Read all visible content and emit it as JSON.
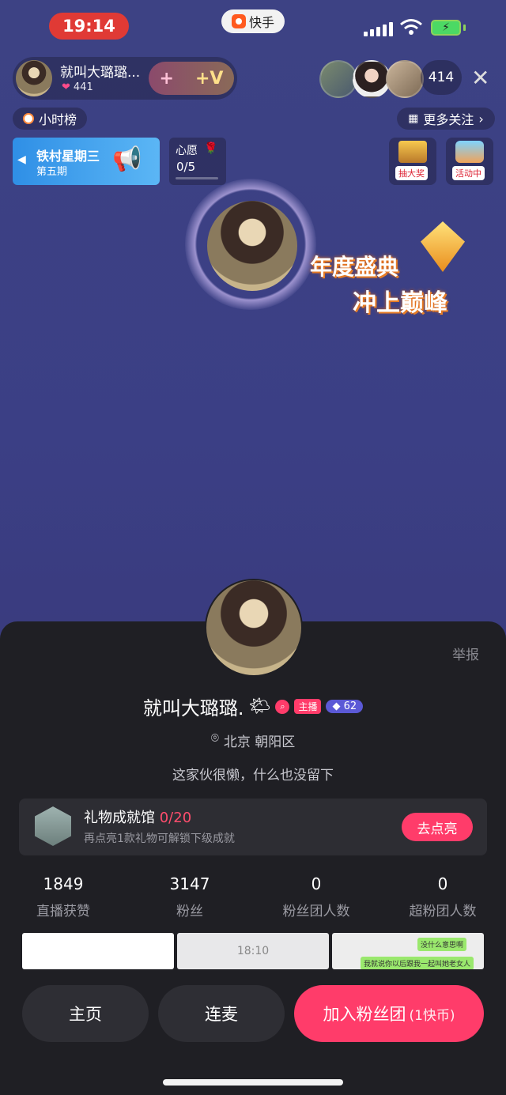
{
  "status_bar": {
    "time": "19:14",
    "app_name": "快手",
    "battery_icon": "charging-bolt"
  },
  "host": {
    "name": "就叫大璐璐...",
    "likes": "441",
    "plus_symbol": "+",
    "v_symbol": "+V"
  },
  "viewers": {
    "count": "414"
  },
  "close_symbol": "✕",
  "rank_label": "小时榜",
  "more_follow_label": "更多关注",
  "banner": {
    "title": "铁村星期三",
    "subtitle": "第五期"
  },
  "wish": {
    "label": "心愿",
    "count": "0/5"
  },
  "tiles": {
    "lottery": "抽大奖",
    "activity": "活动中"
  },
  "promo": {
    "line1": "年度盛典",
    "line2": "冲上巅峰"
  },
  "profile": {
    "report": "举报",
    "name": "就叫大璐璐.",
    "host_badge": "主播",
    "level": "62",
    "location": "北京 朝阳区",
    "bio": "这家伙很懒，什么也没留下"
  },
  "gift_hall": {
    "title": "礼物成就馆",
    "progress": "0/20",
    "subtitle": "再点亮1款礼物可解锁下级成就",
    "button": "去点亮"
  },
  "stats": [
    {
      "value": "1849",
      "label": "直播获赞"
    },
    {
      "value": "3147",
      "label": "粉丝"
    },
    {
      "value": "0",
      "label": "粉丝团人数"
    },
    {
      "value": "0",
      "label": "超粉团人数"
    }
  ],
  "thumbs": {
    "time_label": "18:10",
    "chat1": "没什么意思啊",
    "chat2": "我就说你以后跟我一起叫她老女人"
  },
  "bottom": {
    "home": "主页",
    "mic": "连麦",
    "join": "加入粉丝团",
    "join_price": "(1快币)"
  },
  "colors": {
    "accent": "#ff3c6a",
    "sheet": "#1f1f24",
    "bg": "#3b3f85"
  }
}
